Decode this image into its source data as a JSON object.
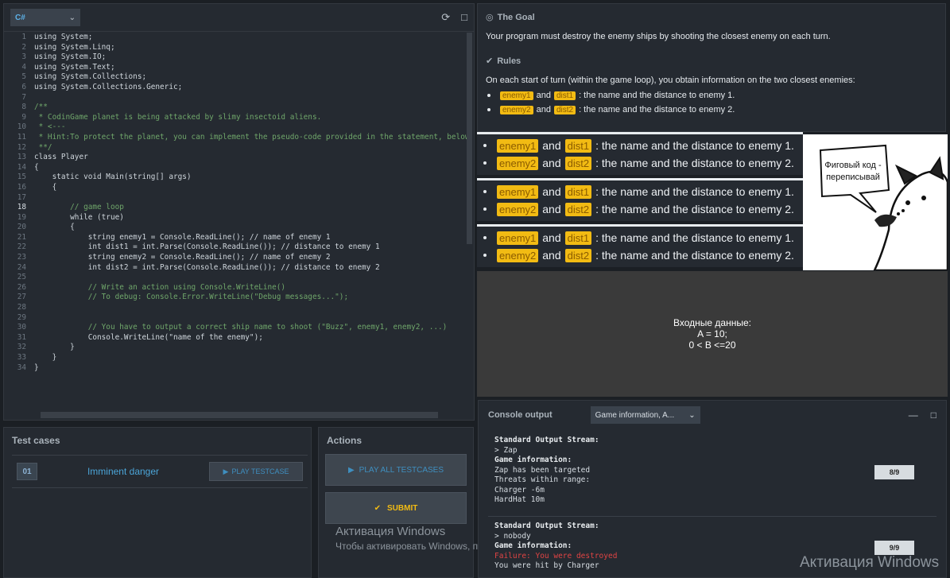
{
  "editor": {
    "language": "C#",
    "lines": [
      {
        "n": "1",
        "t": "using System;"
      },
      {
        "n": "2",
        "t": "using System.Linq;"
      },
      {
        "n": "3",
        "t": "using System.IO;"
      },
      {
        "n": "4",
        "t": "using System.Text;"
      },
      {
        "n": "5",
        "t": "using System.Collections;"
      },
      {
        "n": "6",
        "t": "using System.Collections.Generic;"
      },
      {
        "n": "7",
        "t": ""
      },
      {
        "n": "8",
        "t": "/**"
      },
      {
        "n": "9",
        "t": " * CodinGame planet is being attacked by slimy insectoid aliens."
      },
      {
        "n": "10",
        "t": " * <---"
      },
      {
        "n": "11",
        "t": " * Hint:To protect the planet, you can implement the pseudo-code provided in the statement, below the pla"
      },
      {
        "n": "12",
        "t": " **/"
      },
      {
        "n": "13",
        "t": "class Player"
      },
      {
        "n": "14",
        "t": "{"
      },
      {
        "n": "15",
        "t": "    static void Main(string[] args)"
      },
      {
        "n": "16",
        "t": "    {"
      },
      {
        "n": "17",
        "t": ""
      },
      {
        "n": "18",
        "t": "        // game loop"
      },
      {
        "n": "19",
        "t": "        while (true)"
      },
      {
        "n": "20",
        "t": "        {"
      },
      {
        "n": "21",
        "t": "            string enemy1 = Console.ReadLine(); // name of enemy 1"
      },
      {
        "n": "22",
        "t": "            int dist1 = int.Parse(Console.ReadLine()); // distance to enemy 1"
      },
      {
        "n": "23",
        "t": "            string enemy2 = Console.ReadLine(); // name of enemy 2"
      },
      {
        "n": "24",
        "t": "            int dist2 = int.Parse(Console.ReadLine()); // distance to enemy 2"
      },
      {
        "n": "25",
        "t": ""
      },
      {
        "n": "26",
        "t": "            // Write an action using Console.WriteLine()"
      },
      {
        "n": "27",
        "t": "            // To debug: Console.Error.WriteLine(\"Debug messages...\");"
      },
      {
        "n": "28",
        "t": ""
      },
      {
        "n": "29",
        "t": ""
      },
      {
        "n": "30",
        "t": "            // You have to output a correct ship name to shoot (\"Buzz\", enemy1, enemy2, ...)"
      },
      {
        "n": "31",
        "t": "            Console.WriteLine(\"name of the enemy\");"
      },
      {
        "n": "32",
        "t": "        }"
      },
      {
        "n": "33",
        "t": "    }"
      },
      {
        "n": "34",
        "t": "}"
      }
    ]
  },
  "testcases": {
    "title": "Test cases",
    "items": [
      {
        "num": "01",
        "name": "Imminent danger",
        "play_label": "PLAY TESTCASE"
      }
    ]
  },
  "actions": {
    "title": "Actions",
    "play_all_label": "PLAY ALL TESTCASES",
    "submit_label": "SUBMIT"
  },
  "statement": {
    "goal_title": "The Goal",
    "goal_text": "Your program must destroy the enemy ships by shooting the closest enemy on each turn.",
    "rules_title": "Rules",
    "rules_text": "On each start of turn (within the game loop), you obtain information on the two closest enemies:",
    "bullets": [
      {
        "v1": "enemy1",
        "and": "and",
        "v2": "dist1",
        "text": ": the name and the distance to enemy 1."
      },
      {
        "v1": "enemy2",
        "and": "and",
        "v2": "dist2",
        "text": ": the name and the distance to enemy 2."
      }
    ]
  },
  "meme": {
    "bubble_text": "Фиговый код - переписывай"
  },
  "input_info": {
    "line1": "Входные данные:",
    "line2": "A = 10;",
    "line3": "0 < B <=20"
  },
  "console": {
    "title": "Console output",
    "select_value": "Game information, A...",
    "blocks": [
      {
        "stream_header": "Standard Output Stream:",
        "output": "> Zap",
        "info_header": "Game information:",
        "lines": [
          "Zap has been targeted",
          "Threats within range:",
          "Charger -6m",
          "HardHat 10m"
        ],
        "badge": "8/9"
      },
      {
        "stream_header": "Standard Output Stream:",
        "output": "> nobody",
        "info_header": "Game information:",
        "error": "Failure: You were destroyed",
        "lines": [
          "You were hit by Charger"
        ],
        "badge": "9/9"
      }
    ]
  },
  "watermark": {
    "title": "Активация Windows",
    "subtitle": "Чтобы активировать Windows, п"
  },
  "colors": {
    "accent_blue": "#4ba5d8",
    "accent_yellow": "#f2bb13",
    "error_red": "#e04444"
  }
}
